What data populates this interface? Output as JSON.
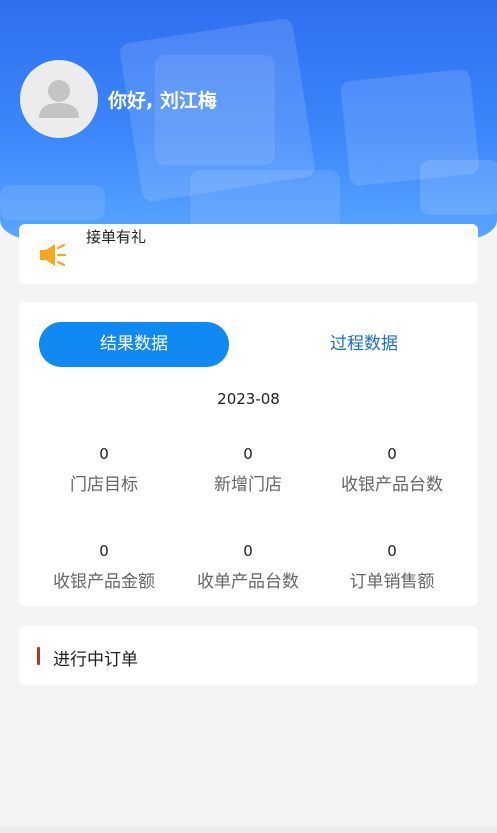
{
  "header": {
    "greeting": "你好, 刘江梅"
  },
  "notice": {
    "icon": "speaker-icon",
    "text": "接单有礼"
  },
  "stats": {
    "tabs": [
      {
        "label": "结果数据",
        "active": true
      },
      {
        "label": "过程数据",
        "active": false
      }
    ],
    "month": "2023-08",
    "items": [
      {
        "value": "0",
        "label": "门店目标"
      },
      {
        "value": "0",
        "label": "新增门店"
      },
      {
        "value": "0",
        "label": "收银产品台数"
      },
      {
        "value": "0",
        "label": "收银产品金额"
      },
      {
        "value": "0",
        "label": "收单产品台数"
      },
      {
        "value": "0",
        "label": "订单销售额"
      }
    ]
  },
  "orders": {
    "title": "进行中订单"
  },
  "colors": {
    "brand_blue": "#1189f3",
    "header_blue": "#3b86fb",
    "accent_red": "#c43022",
    "speaker_orange": "#f5a623"
  }
}
